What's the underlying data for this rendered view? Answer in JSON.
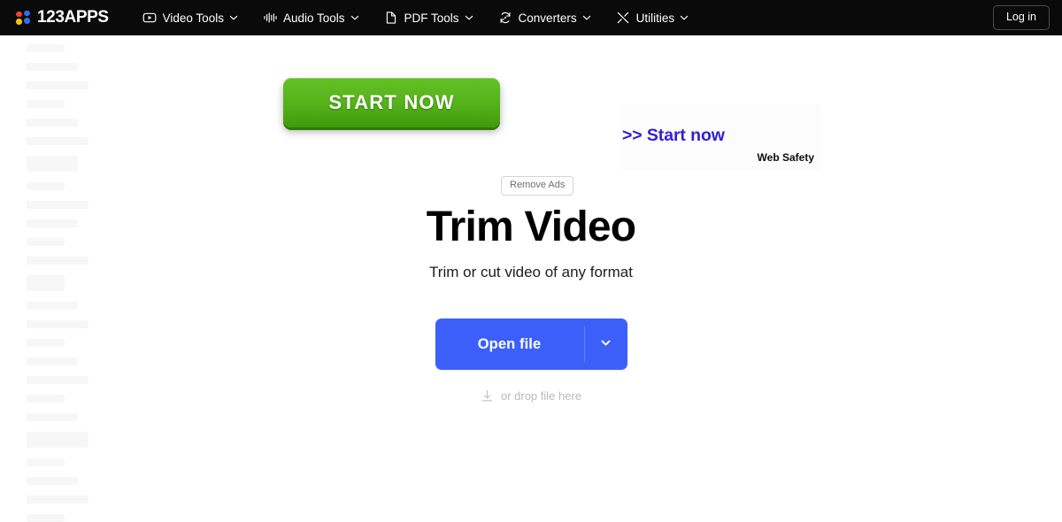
{
  "header": {
    "brand": {
      "name": "123APPS",
      "icon": "dots-logo-icon"
    },
    "nav_items": [
      {
        "label": "Video Tools",
        "icon": "video-play-icon"
      },
      {
        "label": "Audio Tools",
        "icon": "audio-waveform-icon"
      },
      {
        "label": "PDF Tools",
        "icon": "document-page-icon"
      },
      {
        "label": "Converters",
        "icon": "convert-arrows-icon"
      },
      {
        "label": "Utilities",
        "icon": "crossed-tools-icon"
      }
    ],
    "login_label": "Log in"
  },
  "ad": {
    "green_button_label": "START NOW",
    "start_now_link": ">> Start now",
    "web_safety_label": "Web Safety",
    "remove_ads_label": "Remove Ads"
  },
  "main": {
    "title": "Trim Video",
    "subtitle": "Trim or cut video of any format",
    "open_file_label": "Open file",
    "drop_hint": "or drop file here"
  },
  "colors": {
    "nav_background": "#0a0a0a",
    "primary_blue": "#3c5ffa",
    "ad_green_top": "#63c024",
    "ad_green_bottom": "#3f9a0b",
    "ad_link_blue": "#3320d6",
    "page_background": "#ffffff"
  }
}
